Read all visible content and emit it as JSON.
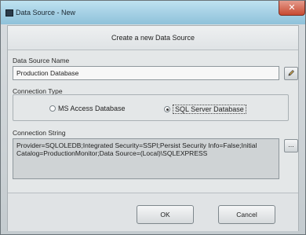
{
  "window": {
    "title": "Data Source - New",
    "close_glyph": "✕",
    "icons": {
      "app": "app-window-icon",
      "close": "close-icon"
    }
  },
  "dialog": {
    "header": "Create a new Data Source",
    "name_label": "Data Source Name",
    "name_value": "Production Database",
    "connection_type_label": "Connection Type",
    "radio_options": [
      {
        "label": "MS Access Database",
        "selected": false
      },
      {
        "label": "SQL Server Database",
        "selected": true
      }
    ],
    "connection_string_label": "Connection String",
    "connection_string_value": "Provider=SQLOLEDB;Integrated Security=SSPI;Persist Security Info=False;Initial Catalog=ProductionMonitor;Data Source=(Local)\\SQLEXPRESS",
    "edit_icon": "pencil-icon",
    "browse_label": "...",
    "ok_label": "OK",
    "cancel_label": "Cancel"
  }
}
